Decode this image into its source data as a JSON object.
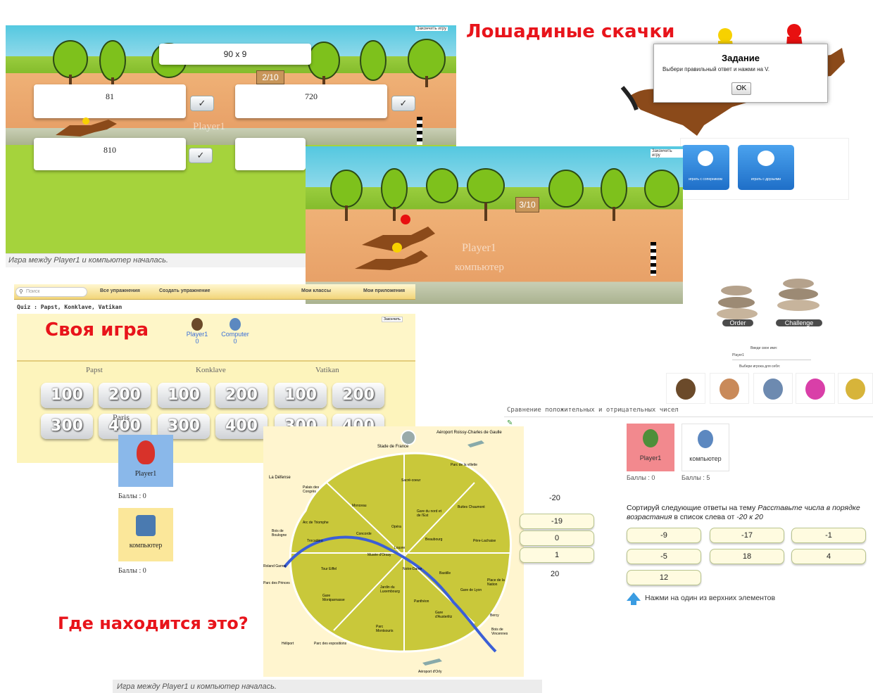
{
  "horse_race": {
    "title": "Лошадиные скачки",
    "top_link": "Закончить игру",
    "question": "90 x 9",
    "progress": "2/10",
    "answers": [
      "81",
      "720",
      "810"
    ],
    "check_glyph": "✓",
    "player_ghost": "Player1",
    "status": "Игра между Player1 и компьютер началась.",
    "progress2": "3/10",
    "player_label": "Player1",
    "computer_label": "компьютер",
    "dialog": {
      "title": "Задание",
      "text": "Выбери правильный ответ и нажми на V.",
      "ok": "OK"
    },
    "mode_buttons": [
      "играть с соперником",
      "играть с друзьями"
    ]
  },
  "quiz": {
    "toolbar": {
      "search_placeholder": "Поиск",
      "all_exercises": "Все упражнения",
      "create_exercise": "Создать упражнение",
      "my_classes": "Мои классы",
      "my_apps": "Мои приложения"
    },
    "quiz_title": "Quiz : Papst, Konklave, Vatikan",
    "title": "Своя игра",
    "corner_link": "Закончить",
    "players": [
      {
        "name": "Player1",
        "score": "0"
      },
      {
        "name": "Computer",
        "score": "0"
      }
    ],
    "categories": [
      "Papst",
      "Konklave",
      "Vatikan"
    ],
    "row1": [
      "100",
      "200",
      "100",
      "200",
      "100",
      "200"
    ],
    "row2": [
      "300",
      "400",
      "300",
      "400",
      "300",
      "400"
    ],
    "row2_overlay": "Paris"
  },
  "map_game": {
    "title": "Где находится это?",
    "player_card": "Player1",
    "computer_card": "компьютер",
    "score_label_p1": "Баллы : 0",
    "score_label_pc": "Баллы : 0",
    "status": "Игра между Player1 и компьютер началась.",
    "labels": {
      "airport_cdg": "Aéroport Roissy-Charles de Gaulle",
      "stade": "Stade de France",
      "sacre": "Sacré-coeur",
      "villette": "Parc de la villette",
      "chaumont": "Buttes Chaumont",
      "defense": "La Défense",
      "palais": "Palais des Congrès",
      "monceau": "Monceau",
      "arc": "Arc de Triomphe",
      "opera": "Opéra",
      "gare_nord": "Gare du nord et de l'Est",
      "boulogne": "Bois de Boulogne",
      "trocadero": "Trocadéro",
      "concorde": "Concorde",
      "orsay": "Musée d'Orsay",
      "louvre": "Louvre",
      "beaubourg": "Beaubourg",
      "lachaise": "Père-Lachaise",
      "eiffel": "Tour Eiffel",
      "notre_dame": "Notre-Dame",
      "bastille": "Bastille",
      "nation": "Place de la Nation",
      "roland": "Roland Garros",
      "princes": "Parc des Princes",
      "luxembourg": "Jardin du Luxembourg",
      "montparnasse": "Gare Montparnasse",
      "gare_lyon": "Gare de Lyon",
      "pantheon": "Panthéon",
      "austerlitz": "Gare d'Austerlitz",
      "bercy": "Bercy",
      "vincennes": "Bois de Vincennes",
      "parc_montsouris": "Parc Montsouris",
      "heliport": "Héliport",
      "expositions": "Parc des expositions",
      "orly": "Aéroport d'Orly"
    }
  },
  "stones": {
    "order": "Order",
    "challenge": "Challenge",
    "enter_name": "Введи свое имя:",
    "name_value": "Player1",
    "choose_player": "Выбери игрока для себя:"
  },
  "sort_game": {
    "title": "Сравнение положительных и отрицательных чисел",
    "player": "Player1",
    "computer": "компьютер",
    "score_p1": "Баллы : 0",
    "score_pc": "Баллы : 5",
    "instruction_prefix": "Сортируй следующие ответы на тему ",
    "instruction_topic": "Расставьте числа в порядке возрастания",
    "instruction_mid": " в список слева от ",
    "instruction_range": "-20 к 20",
    "left_top": "-20",
    "left_list": [
      "-19",
      "0",
      "1"
    ],
    "left_bottom": "20",
    "answers": [
      "-9",
      "-17",
      "-1",
      "-5",
      "18",
      "4",
      "12"
    ],
    "hint": "Нажми на один из верхних элементов"
  },
  "colors": {
    "title_red": "#e8141b",
    "sky": "#54c8e0",
    "grass": "#9acd3e",
    "track": "#e8a168",
    "quiz_bg": "#fdf4bc",
    "map_bg": "#e6e28a",
    "blue_button": "#2d7fd6"
  }
}
